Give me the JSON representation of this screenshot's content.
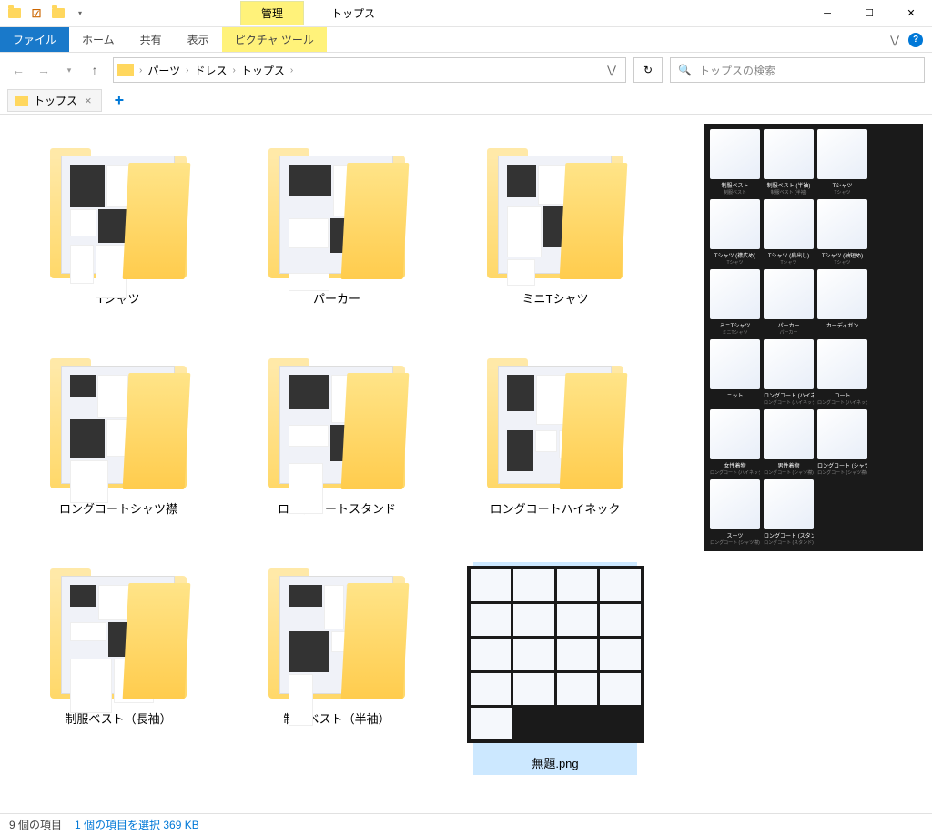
{
  "window": {
    "title": "トップス",
    "manage_tab": "管理"
  },
  "ribbon": {
    "file": "ファイル",
    "home": "ホーム",
    "share": "共有",
    "view": "表示",
    "picture_tools": "ピクチャ ツール"
  },
  "breadcrumb": {
    "seg1": "パーツ",
    "seg2": "ドレス",
    "seg3": "トップス"
  },
  "search": {
    "placeholder": "トップスの検索"
  },
  "tab": {
    "label": "トップス"
  },
  "items": [
    {
      "label": "Tシャツ",
      "type": "folder"
    },
    {
      "label": "パーカー",
      "type": "folder"
    },
    {
      "label": "ミニTシャツ",
      "type": "folder"
    },
    {
      "label": "ロングコートシャツ襟",
      "type": "folder"
    },
    {
      "label": "ロングコートスタンド",
      "type": "folder"
    },
    {
      "label": "ロングコートハイネック",
      "type": "folder"
    },
    {
      "label": "制服ベスト（長袖）",
      "type": "folder"
    },
    {
      "label": "制服ベスト（半袖）",
      "type": "folder"
    },
    {
      "label": "無題.png",
      "type": "file",
      "selected": true
    }
  ],
  "preview_items": [
    {
      "label": "制服ベスト",
      "sub": "制服ベスト"
    },
    {
      "label": "制服ベスト (半袖)",
      "sub": "制服ベスト (半袖)"
    },
    {
      "label": "Tシャツ",
      "sub": "Tシャツ"
    },
    {
      "label": "Tシャツ (襟広め)",
      "sub": "Tシャツ"
    },
    {
      "label": "Tシャツ (肩出し)",
      "sub": "Tシャツ"
    },
    {
      "label": "Tシャツ (袖短め)",
      "sub": "Tシャツ"
    },
    {
      "label": "ミニTシャツ",
      "sub": "ミニTシャツ"
    },
    {
      "label": "パーカー",
      "sub": "パーカー"
    },
    {
      "label": "カーディガン",
      "sub": ""
    },
    {
      "label": "ニット",
      "sub": ""
    },
    {
      "label": "ロングコート (ハイネック)",
      "sub": "ロングコート (ハイネック)"
    },
    {
      "label": "コート",
      "sub": "ロングコート (ハイネック)"
    },
    {
      "label": "女性着物",
      "sub": "ロングコート (ハイネック)"
    },
    {
      "label": "男性着物",
      "sub": "ロングコート (シャツ襟)"
    },
    {
      "label": "ロングコート (シャツ襟)",
      "sub": "ロングコート (シャツ襟)"
    },
    {
      "label": "スーツ",
      "sub": "ロングコート (シャツ襟)"
    },
    {
      "label": "ロングコート (スタンド)",
      "sub": "ロングコート (スタンド)"
    }
  ],
  "status": {
    "count": "9 個の項目",
    "selection": "1 個の項目を選択 369 KB"
  }
}
